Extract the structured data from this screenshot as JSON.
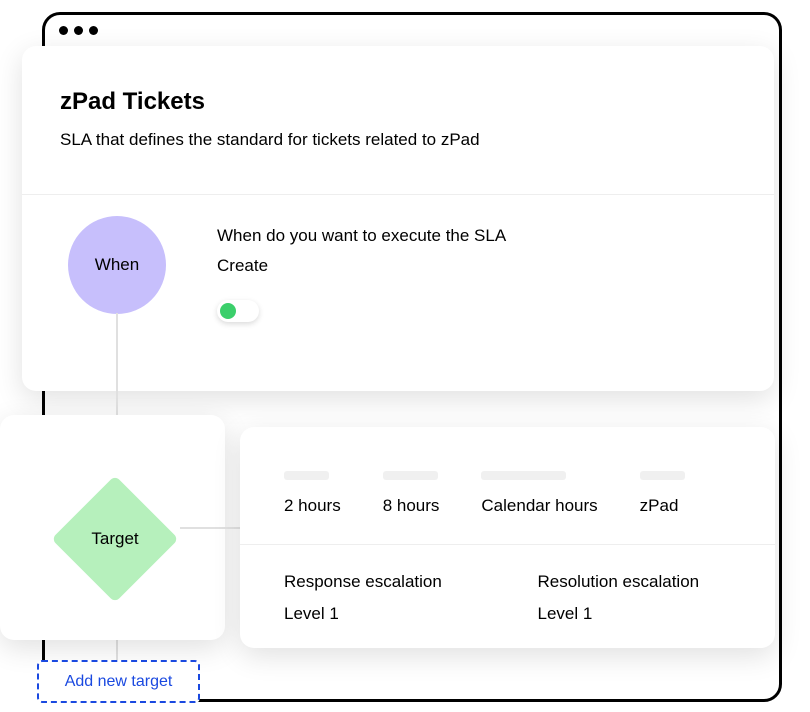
{
  "header": {
    "title": "zPad Tickets",
    "subtitle": "SLA that defines the standard for tickets related to zPad"
  },
  "when_node": {
    "label": "When",
    "question": "When do you want to execute the SLA",
    "value": "Create",
    "toggle_on": true
  },
  "target_node": {
    "label": "Target"
  },
  "targets": {
    "response_time": "2 hours",
    "resolution_time": "8 hours",
    "hours_type": "Calendar hours",
    "product": "zPad"
  },
  "escalations": {
    "response": {
      "title": "Response escalation",
      "level": "Level 1"
    },
    "resolution": {
      "title": "Resolution escalation",
      "level": "Level 1"
    }
  },
  "add_target_label": "Add new target"
}
